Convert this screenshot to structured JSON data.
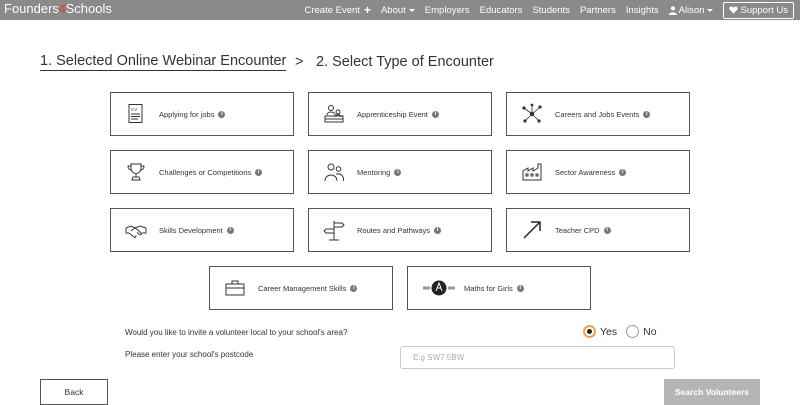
{
  "navbar": {
    "brand_pre": "Founders",
    "brand_mid": "4",
    "brand_post": "Schools",
    "create_event": "Create Event",
    "about": "About",
    "employers": "Employers",
    "educators": "Educators",
    "students": "Students",
    "partners": "Partners",
    "insights": "Insights",
    "user": "Alison",
    "support": "Support Us"
  },
  "steps": {
    "step1": "1. Selected Online Webinar Encounter",
    "separator": ">",
    "step2": "2. Select Type of Encounter"
  },
  "cards": [
    {
      "label": "Applying for jobs",
      "icon": "cv-document-icon"
    },
    {
      "label": "Apprenticeship Event",
      "icon": "apprenticeship-icon"
    },
    {
      "label": "Careers and Jobs Events",
      "icon": "network-icon"
    },
    {
      "label": "Challenges or Competitions",
      "icon": "trophy-icon"
    },
    {
      "label": "Mentoring",
      "icon": "people-icon"
    },
    {
      "label": "Sector Awareness",
      "icon": "factory-icon"
    },
    {
      "label": "Skills Development",
      "icon": "handshake-icon"
    },
    {
      "label": "Routes and Pathways",
      "icon": "signpost-icon"
    },
    {
      "label": "Teacher CPD",
      "icon": "arrow-up-right-icon"
    },
    {
      "label": "Career Management Skills",
      "icon": "briefcase-icon"
    },
    {
      "label": "Maths for Girls",
      "icon": "maths-for-girls-logo-icon"
    }
  ],
  "form": {
    "question_volunteer": "Would you like to invite a volunteer local to your school's area?",
    "yes": "Yes",
    "no": "No",
    "selected": "Yes",
    "question_postcode": "Please enter your school's postcode",
    "postcode_placeholder": "E.g SW7 5BW",
    "postcode_value": ""
  },
  "buttons": {
    "back": "Back",
    "search": "Search Volunteers"
  },
  "colors": {
    "navbar": "#8a8a8a",
    "brand_accent": "#e8463a",
    "radio_selected": "#f0a24a",
    "search_button": "#b5b5b5"
  }
}
